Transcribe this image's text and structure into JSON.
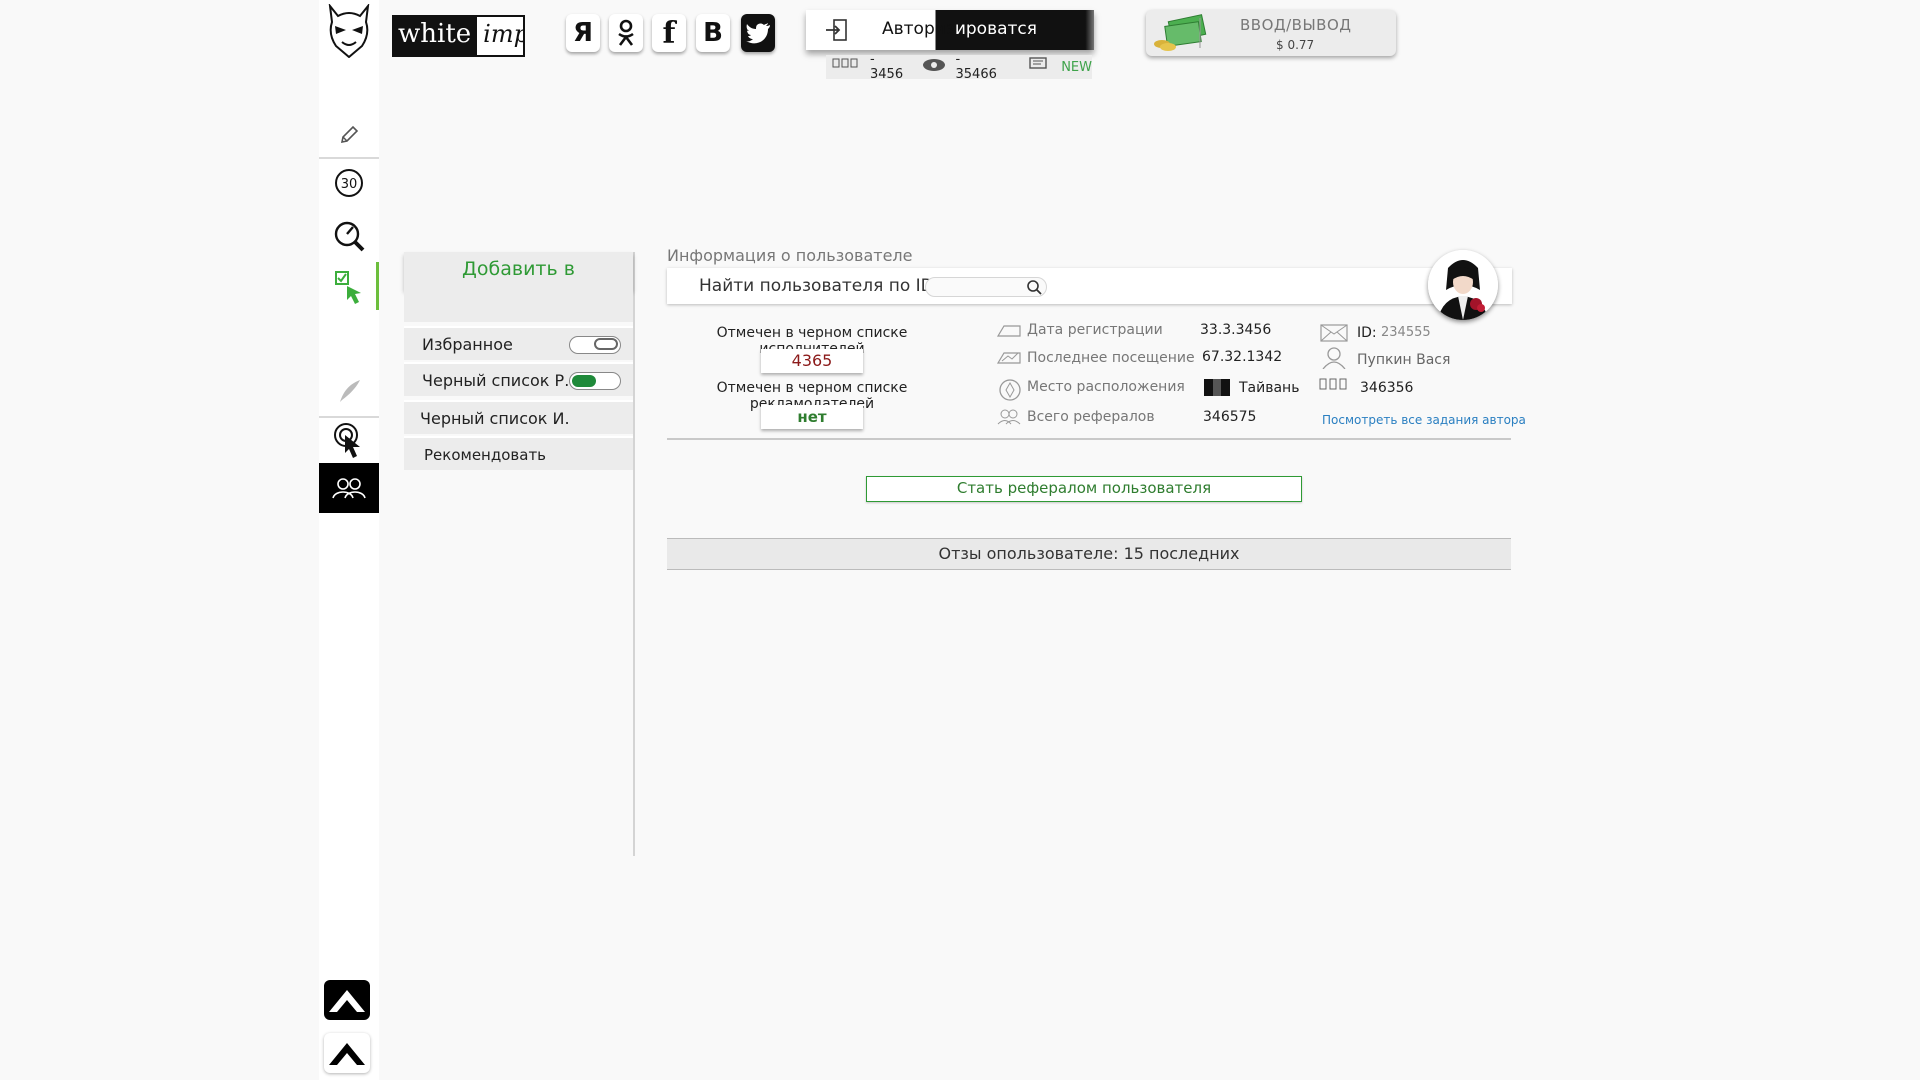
{
  "header": {
    "brand_white": "white",
    "brand_imp": "imp",
    "social": [
      {
        "name": "yandex",
        "label": "Я"
      },
      {
        "name": "odnoklassniki",
        "label": "ok-icon"
      },
      {
        "name": "facebook",
        "label": "f"
      },
      {
        "name": "vkontakte",
        "label": "В"
      },
      {
        "name": "twitter",
        "label": "twitter-icon"
      }
    ],
    "login_label_dark": "Авториз",
    "login_label_light": "ировaтся",
    "stats": {
      "tasks": "- 3456",
      "views": "- 35466",
      "messages": "NEW"
    },
    "wallet": {
      "title": "ВВОД/ВЫВОД",
      "balance": "$ 0.77"
    }
  },
  "sidebar": {
    "items": [
      {
        "name": "edit-icon"
      },
      {
        "name": "timer-30-icon",
        "label": "30"
      },
      {
        "name": "speed-search-icon"
      },
      {
        "name": "tasks-pointer-icon",
        "active": true
      },
      {
        "name": "pen-icon"
      },
      {
        "name": "touch-icon"
      },
      {
        "name": "referrals-icon",
        "selected": true
      }
    ]
  },
  "panel": {
    "title": "Добавить в",
    "rows": [
      {
        "label": "Избранное",
        "toggle": "off"
      },
      {
        "label": "Черный список Р.",
        "toggle": "on"
      },
      {
        "label": "Черный список И."
      },
      {
        "label": "Рекомендовать"
      }
    ]
  },
  "main": {
    "section_title": "Информация о пользователе",
    "search_label": "Найти пользователя по ID:",
    "blacklist_exec_label": "Отмечен в черном списке исполнителей",
    "blacklist_exec_value": "4365",
    "blacklist_adv_label": "Отмечен в черном списке рекламодателей",
    "blacklist_adv_value": "нет",
    "info": {
      "reg_label": "Дата регистрации",
      "reg_value": "33.3.3456",
      "last_label": "Последнее посещение",
      "last_value": "67.32.1342",
      "loc_label": "Место расположения",
      "loc_value": "Тайвань",
      "refs_label": "Всего рефералов",
      "refs_value": "346575"
    },
    "user": {
      "id_label": "ID:",
      "id_value": "234555",
      "name": "Пупкин Вася",
      "tasks": "346356",
      "all_tasks_link": "Посмотреть все задания автора"
    },
    "cta": "Стать рефералом пользователя",
    "reviews": "Отзы опользователе: 15 последних"
  },
  "colors": {
    "accent": "#2f9a35",
    "active_rail": "#6cbe3c",
    "toggle_on": "#1f8a3a",
    "link": "#2a7fc1",
    "value_red": "#8b1a1a"
  }
}
